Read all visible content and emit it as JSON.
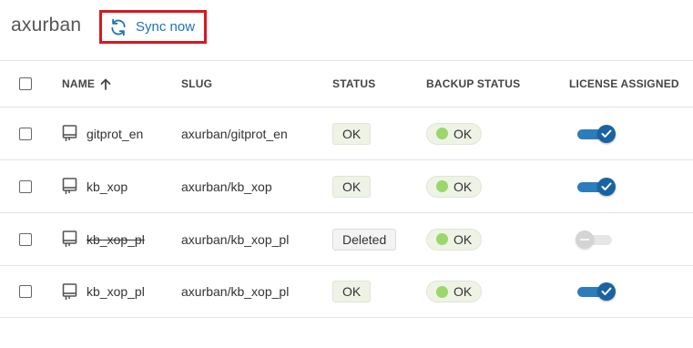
{
  "header": {
    "org_name": "axurban",
    "sync_label": "Sync now"
  },
  "table": {
    "columns": {
      "name": "NAME",
      "slug": "SLUG",
      "status": "STATUS",
      "backup_status": "BACKUP STATUS",
      "license": "LICENSE ASSIGNED"
    },
    "sort": {
      "column": "name",
      "direction": "ascending"
    },
    "rows": [
      {
        "name": "gitprot_en",
        "slug": "axurban/gitprot_en",
        "status": "OK",
        "backup_status": "OK",
        "license_assigned": true,
        "deleted": false,
        "checked": false
      },
      {
        "name": "kb_xop",
        "slug": "axurban/kb_xop",
        "status": "OK",
        "backup_status": "OK",
        "license_assigned": true,
        "deleted": false,
        "checked": false
      },
      {
        "name": "kb_xop_pl",
        "slug": "axurban/kb_xop_pl",
        "status": "Deleted",
        "backup_status": "OK",
        "license_assigned": false,
        "deleted": true,
        "checked": false
      },
      {
        "name": "kb_xop_pl",
        "slug": "axurban/kb_xop_pl",
        "status": "OK",
        "backup_status": "OK",
        "license_assigned": true,
        "deleted": false,
        "checked": false
      }
    ]
  },
  "colors": {
    "accent": "#1a73b8",
    "highlight_border": "#d9171f",
    "backup_ok_dot": "#9bd76b",
    "toggle_on": "#1a63a3",
    "toggle_off": "#d4d4d4"
  },
  "icons": {
    "sync": "sync-icon",
    "sort": "arrow-up-icon",
    "repository": "repository-icon",
    "toggle_check": "checkmark-icon"
  }
}
